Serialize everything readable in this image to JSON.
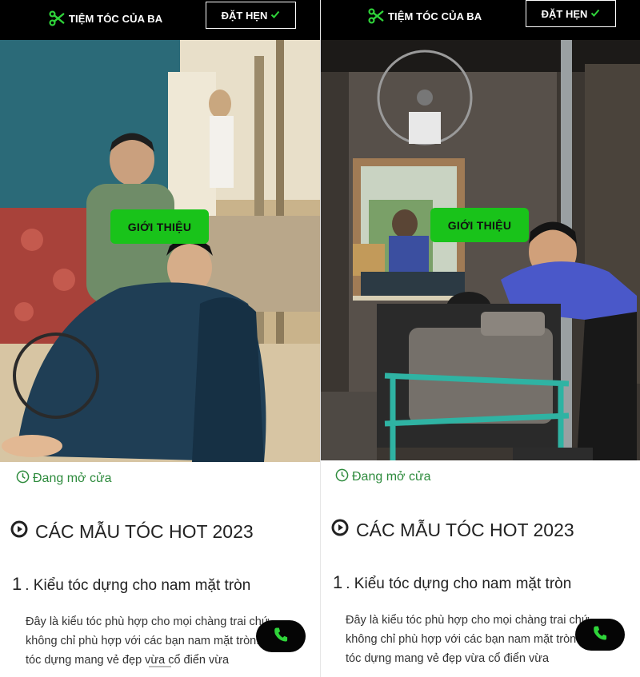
{
  "panels": [
    {
      "brand": "TIỆM TÓC CỦA BA",
      "book_button": "ĐẶT HẸN",
      "hero_button": "GIỚI THIỆU",
      "open_status": "Đang mở cửa",
      "section_title": "CÁC MẪU TÓC HOT 2023",
      "item_number": "1",
      "item_title": ". Kiểu tóc dựng cho nam mặt tròn",
      "body_text": "Đây là kiểu tóc phù hợp cho mọi chàng trai chứ không chỉ phù hợp với các bạn nam mặt tròn. Kiểu tóc dựng mang vẻ đẹp vừa cổ điển vừa"
    },
    {
      "brand": "TIỆM TÓC CỦA BA",
      "book_button": "ĐẶT HẸN",
      "hero_button": "GIỚI THIỆU",
      "open_status": "Đang mở cửa",
      "section_title": "CÁC MẪU TÓC HOT 2023",
      "item_number": "1",
      "item_title": ". Kiểu tóc dựng cho nam mặt tròn",
      "body_text": "Đây là kiểu tóc phù hợp cho mọi chàng trai chứ không chỉ phù hợp với các bạn nam mặt tròn. Kiểu tóc dựng mang vẻ đẹp vừa cổ điển vừa"
    }
  ],
  "colors": {
    "accent_green": "#19c31a",
    "brand_icon_green": "#2fd43a",
    "status_green": "#2e8b3d",
    "topbar": "#000000"
  },
  "icons": {
    "brand": "scissors-icon",
    "book": "check-icon",
    "status": "clock-icon",
    "section": "play-circle-icon",
    "call": "phone-icon"
  }
}
